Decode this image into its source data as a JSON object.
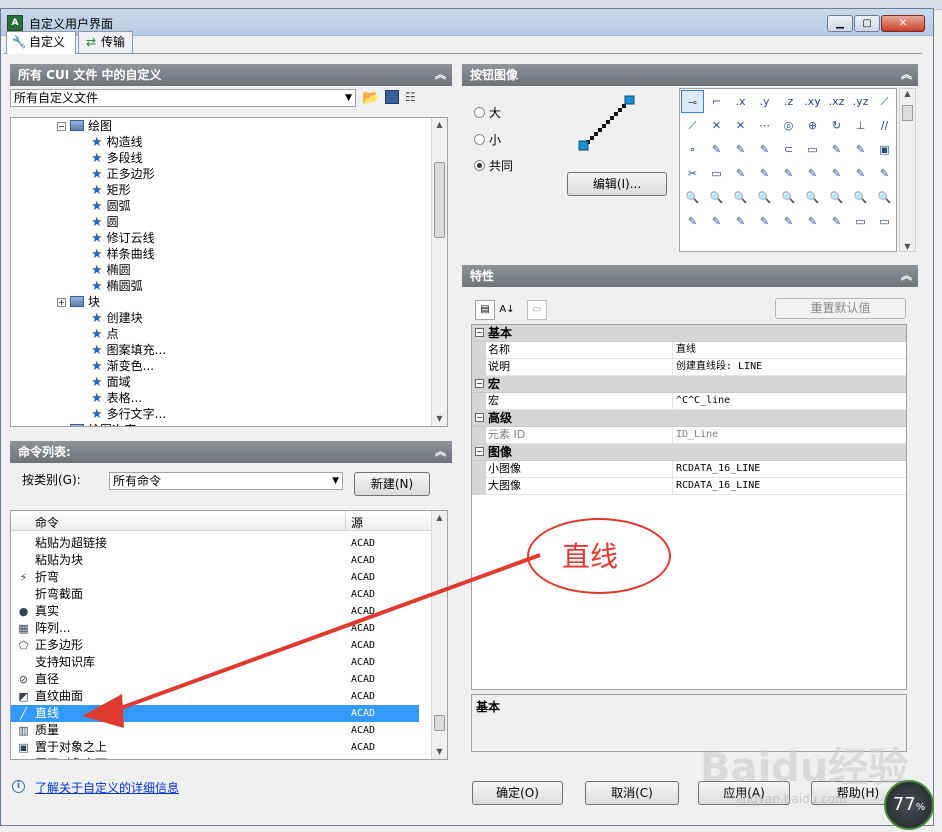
{
  "window": {
    "title": "自定义用户界面"
  },
  "tabs": [
    {
      "label": "自定义",
      "icon": "wrench-icon"
    },
    {
      "label": "传输",
      "icon": "arrows-icon"
    }
  ],
  "cui_panel": {
    "header": "所有 CUI 文件 中的自定义",
    "file_select": "所有自定义文件",
    "tree": [
      {
        "label": "绘图",
        "type": "group"
      },
      {
        "label": "构造线"
      },
      {
        "label": "多段线"
      },
      {
        "label": "正多边形"
      },
      {
        "label": "矩形"
      },
      {
        "label": "圆弧"
      },
      {
        "label": "圆"
      },
      {
        "label": "修订云线"
      },
      {
        "label": "样条曲线"
      },
      {
        "label": "椭圆"
      },
      {
        "label": "椭圆弧"
      },
      {
        "label": "块",
        "type": "group"
      },
      {
        "label": "创建块"
      },
      {
        "label": "点"
      },
      {
        "label": "图案填充..."
      },
      {
        "label": "渐变色..."
      },
      {
        "label": "面域"
      },
      {
        "label": "表格..."
      },
      {
        "label": "多行文字..."
      },
      {
        "label": "绘图次序",
        "type": "group"
      }
    ]
  },
  "command_panel": {
    "header": "命令列表:",
    "category_label": "按类别(G):",
    "category_value": "所有命令",
    "new_button": "新建(N)",
    "col_command": "命令",
    "col_source": "源",
    "rows": [
      {
        "name": "粘贴为超链接",
        "source": "ACAD",
        "icon": ""
      },
      {
        "name": "粘贴为块",
        "source": "ACAD",
        "icon": ""
      },
      {
        "name": "折弯",
        "source": "ACAD",
        "icon": "jog-icon"
      },
      {
        "name": "折弯截面",
        "source": "ACAD",
        "icon": ""
      },
      {
        "name": "真实",
        "source": "ACAD",
        "icon": "realistic-icon"
      },
      {
        "name": "阵列...",
        "source": "ACAD",
        "icon": "array-icon"
      },
      {
        "name": "正多边形",
        "source": "ACAD",
        "icon": "polygon-icon"
      },
      {
        "name": "支持知识库",
        "source": "ACAD",
        "icon": ""
      },
      {
        "name": "直径",
        "source": "ACAD",
        "icon": "diameter-icon"
      },
      {
        "name": "直纹曲面",
        "source": "ACAD",
        "icon": "ruled-surface-icon"
      },
      {
        "name": "直线",
        "source": "ACAD",
        "icon": "line-icon",
        "selected": true
      },
      {
        "name": "质量",
        "source": "ACAD",
        "icon": "mass-icon"
      },
      {
        "name": "置于对象之上",
        "source": "ACAD",
        "icon": "bring-above-icon"
      },
      {
        "name": "置于对象之下",
        "source": "ACAD",
        "icon": "bring-under-icon"
      }
    ]
  },
  "link_text": "了解关于自定义的详细信息",
  "button_image": {
    "header": "按钮图像",
    "radio_large": "大",
    "radio_small": "小",
    "radio_both": "共同",
    "selected_radio": "共同",
    "edit_button": "编辑(I)...",
    "grid": [
      "⊸",
      "⌐",
      ".x",
      ".y",
      ".z",
      ".xy",
      ".xz",
      ".yz",
      "⟋",
      "⟋",
      "✕",
      "✕",
      "⋯",
      "◎",
      "⊕",
      "↻",
      "⊥",
      "∕∕",
      "∘",
      "✎",
      "✎",
      "✎",
      "⊂",
      "▭",
      "✎",
      "✎",
      "▣",
      "✂",
      "▭",
      "✎",
      "✎",
      "✎",
      "✎",
      "✎",
      "✎",
      "✎",
      "🔍",
      "🔍",
      "🔍",
      "🔍",
      "🔍",
      "🔍",
      "🔍",
      "🔍",
      "🔍",
      "✎",
      "✎",
      "✎",
      "✎",
      "✎",
      "✎",
      "✎",
      "▭",
      "▭"
    ]
  },
  "properties": {
    "header": "特性",
    "reset_button": "重置默认值",
    "categories": [
      {
        "name": "基本",
        "rows": [
          {
            "name": "名称",
            "value": "直线"
          },
          {
            "name": "说明",
            "value": "创建直线段:  LINE"
          }
        ]
      },
      {
        "name": "宏",
        "rows": [
          {
            "name": "宏",
            "value": "^C^C_line"
          }
        ]
      },
      {
        "name": "高级",
        "rows": [
          {
            "name": "元素 ID",
            "value": "ID_Line",
            "readonly": true
          }
        ]
      },
      {
        "name": "图像",
        "rows": [
          {
            "name": "小图像",
            "value": "RCDATA_16_LINE"
          },
          {
            "name": "大图像",
            "value": "RCDATA_16_LINE"
          }
        ]
      }
    ],
    "description_title": "基本"
  },
  "footer": {
    "ok": "确定(O)",
    "cancel": "取消(C)",
    "apply": "应用(A)",
    "help": "帮助(H)"
  },
  "annotation": {
    "text": "直线",
    "color": "#e03a30"
  },
  "watermark": {
    "main": "Baidu经验",
    "sub": "jingyan.baidu.com"
  },
  "gauge": {
    "value": "77"
  },
  "colors": {
    "selection": "#3399ff",
    "panel_header": "#7a7e84",
    "star": "#2764b5"
  }
}
